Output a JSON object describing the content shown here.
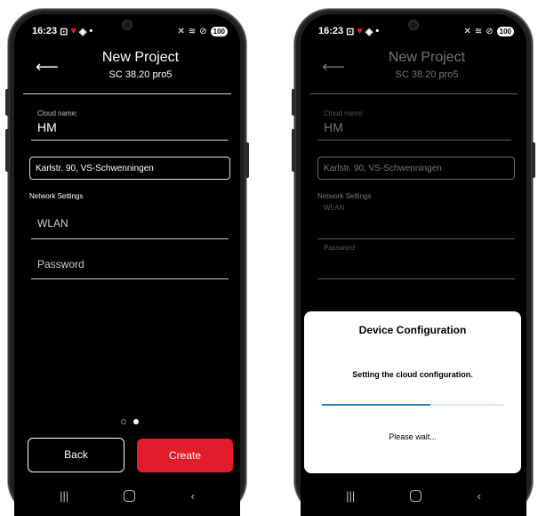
{
  "status_bar": {
    "time": "16:23",
    "battery": "100"
  },
  "header": {
    "title": "New Project",
    "subtitle": "SC 38.20 pro5"
  },
  "form": {
    "cloud_name_label": "Cloud name:",
    "cloud_name_value": "HM",
    "address_value": "Karlstr. 90, VS-Schwenningen",
    "network_settings_label": "Network Settings",
    "wlan_placeholder": "WLAN",
    "password_placeholder": "Password"
  },
  "buttons": {
    "back": "Back",
    "create": "Create"
  },
  "pager": {
    "pages": 2,
    "active": 2
  },
  "dialog": {
    "title": "Device Configuration",
    "message": "Setting the cloud configuration.",
    "wait": "Please wait...",
    "progress": 0.6
  },
  "colors": {
    "accent_red": "#e21c2a",
    "progress_blue": "#2a7fc0"
  }
}
